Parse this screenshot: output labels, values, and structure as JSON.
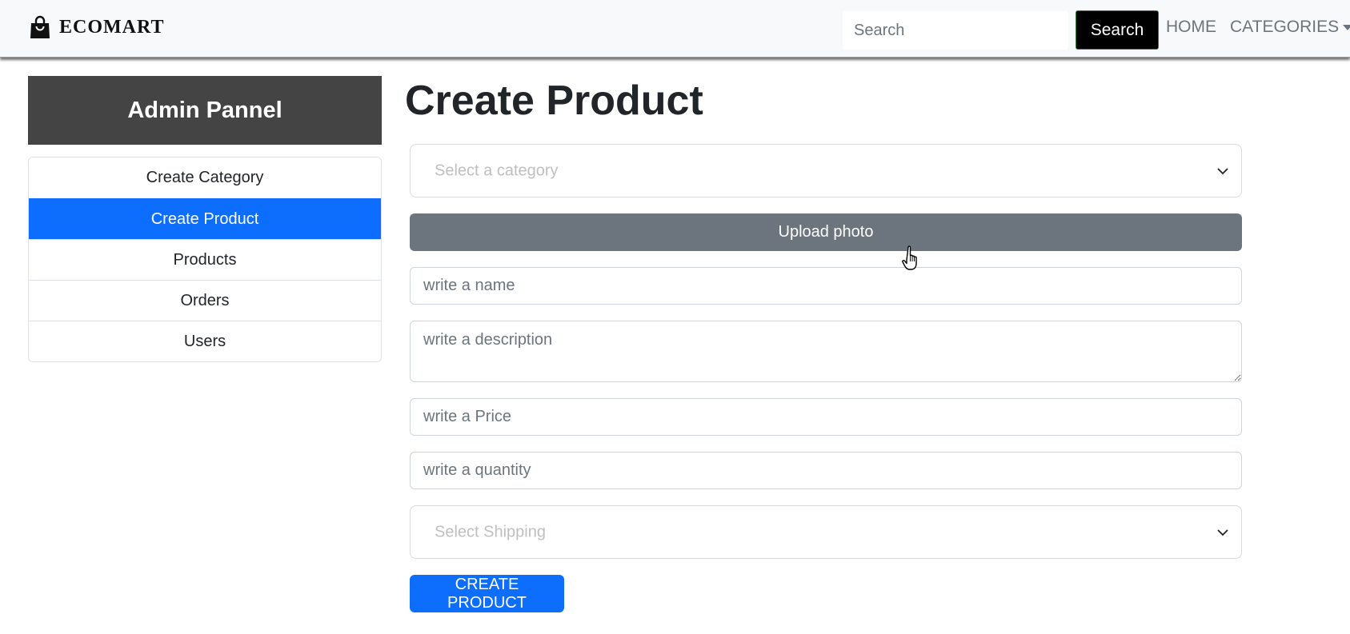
{
  "navbar": {
    "brand": "ECOMART",
    "brand_icon": "shopping-bag-icon",
    "search_placeholder": "Search",
    "search_button": "Search",
    "links": {
      "home": "HOME",
      "categories": "CATEGORIES"
    }
  },
  "sidebar": {
    "title": "Admin Pannel",
    "items": [
      {
        "label": "Create Category",
        "active": false
      },
      {
        "label": "Create Product",
        "active": true
      },
      {
        "label": "Products",
        "active": false
      },
      {
        "label": "Orders",
        "active": false
      },
      {
        "label": "Users",
        "active": false
      }
    ]
  },
  "main": {
    "title": "Create Product",
    "category_select_placeholder": "Select a category",
    "upload_button": "Upload photo",
    "name_placeholder": "write a name",
    "description_placeholder": "write a description",
    "price_placeholder": "write a Price",
    "quantity_placeholder": "write a quantity",
    "shipping_select_placeholder": "Select Shipping",
    "submit_button": "CREATE PRODUCT"
  },
  "colors": {
    "primary": "#0d6efd",
    "secondary": "#6c757d",
    "sidebar_header": "#444444",
    "navbar_bg": "#f8f9fa",
    "search_button_bg": "#000000"
  },
  "icons": {
    "brand": "shopping-bag-icon",
    "select_chevron": "chevron-down-icon",
    "categories_caret": "caret-down-icon",
    "mouse_cursor": "hand-pointer-cursor-icon"
  }
}
